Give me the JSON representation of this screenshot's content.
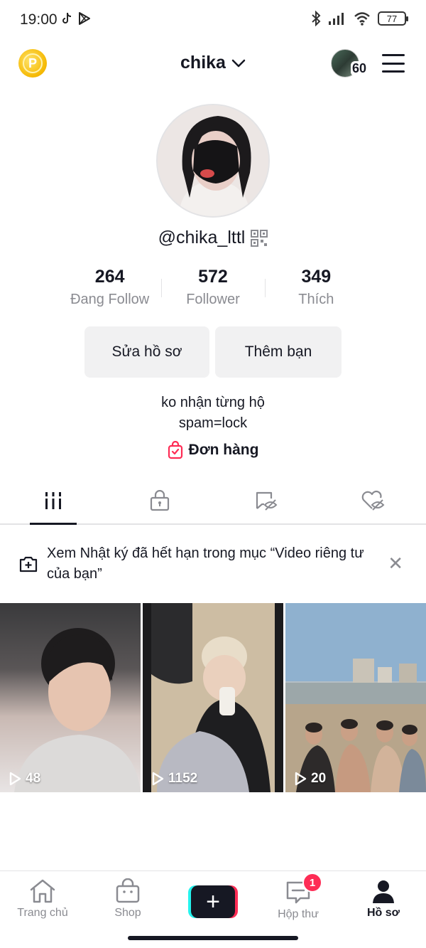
{
  "status_bar": {
    "time": "19:00",
    "battery": "77",
    "icons": [
      "tiktok-icon",
      "play-store-icon",
      "bluetooth-icon",
      "signal-icon",
      "wifi-icon",
      "battery-icon"
    ]
  },
  "header": {
    "username": "chika",
    "friend_count": "60"
  },
  "profile": {
    "handle": "@chika_lttl",
    "stats": [
      {
        "value": "264",
        "label": "Đang Follow"
      },
      {
        "value": "572",
        "label": "Follower"
      },
      {
        "value": "349",
        "label": "Thích"
      }
    ],
    "edit_button": "Sửa hồ sơ",
    "add_friend_button": "Thêm bạn",
    "bio_line1": "ko nhận từng hộ",
    "bio_line2": "spam=lock",
    "orders_label": "Đơn hàng"
  },
  "tabs": [
    {
      "name": "videos",
      "icon": "grid-icon",
      "active": true
    },
    {
      "name": "private",
      "icon": "lock-icon",
      "active": false
    },
    {
      "name": "reposts",
      "icon": "hidden-repost-icon",
      "active": false
    },
    {
      "name": "liked",
      "icon": "hidden-heart-icon",
      "active": false
    }
  ],
  "banner": {
    "text": "Xem Nhật ký đã hết hạn trong mục “Video riêng tư của bạn”"
  },
  "videos": [
    {
      "plays": "48"
    },
    {
      "plays": "1152"
    },
    {
      "plays": "20"
    }
  ],
  "bottom_nav": {
    "home": "Trang chủ",
    "shop": "Shop",
    "inbox": "Hộp thư",
    "inbox_badge": "1",
    "profile": "Hồ sơ"
  },
  "colors": {
    "accent_red": "#fe2c55",
    "accent_cyan": "#25f4ee",
    "text_primary": "#161823",
    "text_secondary": "#8a8b91",
    "button_bg": "#f1f1f2"
  }
}
